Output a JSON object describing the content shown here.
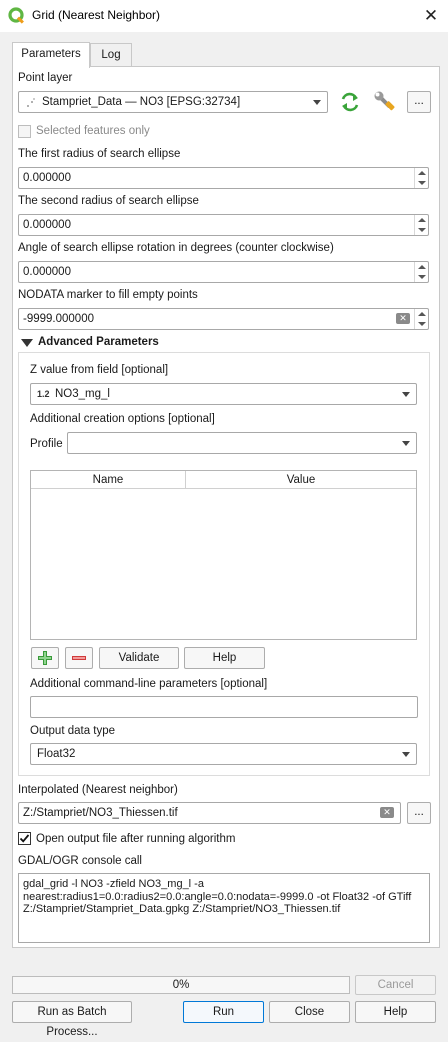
{
  "window": {
    "title": "Grid (Nearest Neighbor)",
    "close_glyph": "✕"
  },
  "tabs": [
    "Parameters",
    "Log"
  ],
  "point_layer": {
    "label": "Point layer",
    "value": "Stampriet_Data — NO3 [EPSG:32734]",
    "more": "..."
  },
  "selected_only": {
    "label": "Selected features only"
  },
  "radius1": {
    "label": "The first radius of search ellipse",
    "value": "0.000000"
  },
  "radius2": {
    "label": "The second radius of search ellipse",
    "value": "0.000000"
  },
  "angle": {
    "label": "Angle of search ellipse rotation in degrees (counter clockwise)",
    "value": "0.000000"
  },
  "nodata": {
    "label": "NODATA marker to fill empty points",
    "value": "-9999.000000"
  },
  "advanced": {
    "header": "Advanced Parameters",
    "z_field": {
      "label": "Z value from field [optional]",
      "type_badge": "1.2",
      "value": "NO3_mg_l"
    },
    "creation_options": {
      "label": "Additional creation options [optional]",
      "profile_label": "Profile",
      "profile_value": ""
    },
    "table": {
      "columns": [
        "Name",
        "Value"
      ]
    },
    "buttons": {
      "validate": "Validate",
      "help": "Help"
    },
    "cmdline": {
      "label": "Additional command-line parameters [optional]",
      "value": ""
    },
    "output_type": {
      "label": "Output data type",
      "value": "Float32"
    }
  },
  "interpolated": {
    "label": "Interpolated (Nearest neighbor)",
    "value": "Z:/Stampriet/NO3_Thiessen.tif",
    "more": "..."
  },
  "open_output": {
    "label": "Open output file after running algorithm",
    "checked": true
  },
  "console": {
    "label": "GDAL/OGR console call",
    "text": "gdal_grid -l NO3 -zfield NO3_mg_l -a\nnearest:radius1=0.0:radius2=0.0:angle=0.0:nodata=-9999.0 -ot Float32 -of GTiff\nZ:/Stampriet/Stampriet_Data.gpkg Z:/Stampriet/NO3_Thiessen.tif"
  },
  "progress": {
    "value": 0,
    "text": "0%"
  },
  "footer": {
    "cancel": "Cancel",
    "batch": "Run as Batch Process...",
    "run": "Run",
    "close": "Close",
    "help": "Help"
  },
  "colors": {
    "qgis_green": "#5fb643",
    "accent": "#0078d7"
  },
  "icons": [
    "qgis-logo-icon",
    "close-icon",
    "point-layer-icon",
    "iterate-icon",
    "wrench-icon",
    "chevron-down-icon",
    "plus-icon",
    "minus-icon",
    "clear-icon",
    "checkmark-icon"
  ]
}
